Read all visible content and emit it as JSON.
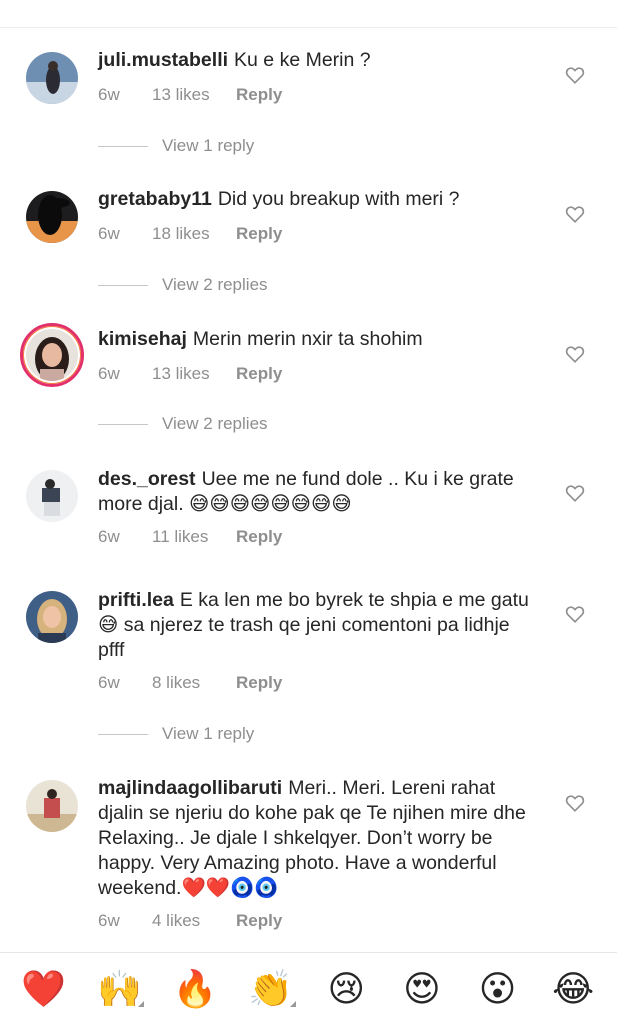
{
  "comments": [
    {
      "username": "juli.mustabelli",
      "text": "Ku e ke Merin ?",
      "time": "6w",
      "likes": "13 likes",
      "reply": "Reply",
      "view_replies": "View 1 reply"
    },
    {
      "username": "gretababy11",
      "text": "Did you breakup with meri ?",
      "time": "6w",
      "likes": "18 likes",
      "reply": "Reply",
      "view_replies": "View 2 replies"
    },
    {
      "username": "kimisehaj",
      "text": "Merin merin nxir ta shohim",
      "time": "6w",
      "likes": "13 likes",
      "reply": "Reply",
      "view_replies": "View 2 replies"
    },
    {
      "username": "des._orest",
      "text": "Uee me ne fund dole .. Ku i ke grate more djal. 😅😅😅😅😅😅😅😅",
      "time": "6w",
      "likes": "11 likes",
      "reply": "Reply"
    },
    {
      "username": "prifti.lea",
      "text": "E ka len me bo byrek te shpia e me gatu😅 sa njerez te trash qe jeni comentoni pa lidhje pfff",
      "time": "6w",
      "likes": "8 likes",
      "reply": "Reply",
      "view_replies": "View 1 reply"
    },
    {
      "username": "majlindaagollibaruti",
      "text": "Meri.. Meri. Lereni rahat djalin se njeriu do kohe pak qe Te njihen mire dhe Relaxing.. Je djale I shkelqyer. Don’t worry be happy. Very Amazing photo. Have a wonderful weekend.❤️❤️🧿🧿",
      "time": "6w",
      "likes": "4 likes",
      "reply": "Reply"
    }
  ],
  "emoji_bar": [
    "❤️",
    "🙌",
    "🔥",
    "👏",
    "😢",
    "😍",
    "😮",
    "😂"
  ],
  "icons": {
    "like": "heart-outline-icon"
  },
  "colors": {
    "text": "#262626",
    "meta": "#8e8e8e",
    "story_ring": "#e1306c"
  }
}
